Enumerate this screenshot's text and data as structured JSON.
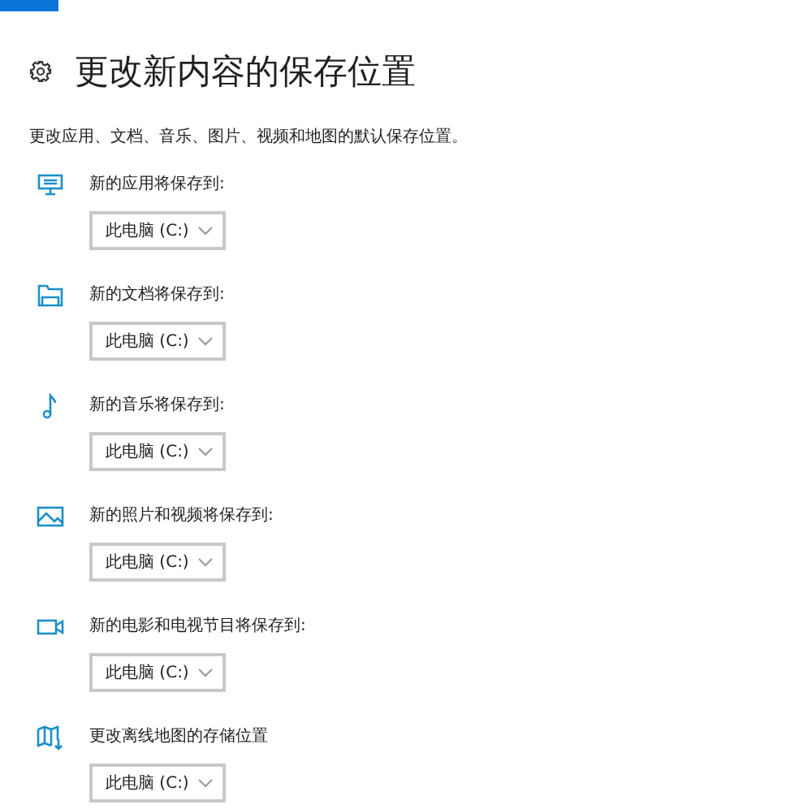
{
  "title": "更改新内容的保存位置",
  "description": "更改应用、文档、音乐、图片、视频和地图的默认保存位置。",
  "locations": [
    {
      "kind": "apps",
      "label": "新的应用将保存到:",
      "value": "此电脑 (C:)"
    },
    {
      "kind": "documents",
      "label": "新的文档将保存到:",
      "value": "此电脑 (C:)"
    },
    {
      "kind": "music",
      "label": "新的音乐将保存到:",
      "value": "此电脑 (C:)"
    },
    {
      "kind": "photos",
      "label": "新的照片和视频将保存到:",
      "value": "此电脑 (C:)"
    },
    {
      "kind": "movies",
      "label": "新的电影和电视节目将保存到:",
      "value": "此电脑 (C:)"
    },
    {
      "kind": "maps",
      "label": "更改离线地图的存储位置",
      "value": "此电脑 (C:)"
    }
  ]
}
